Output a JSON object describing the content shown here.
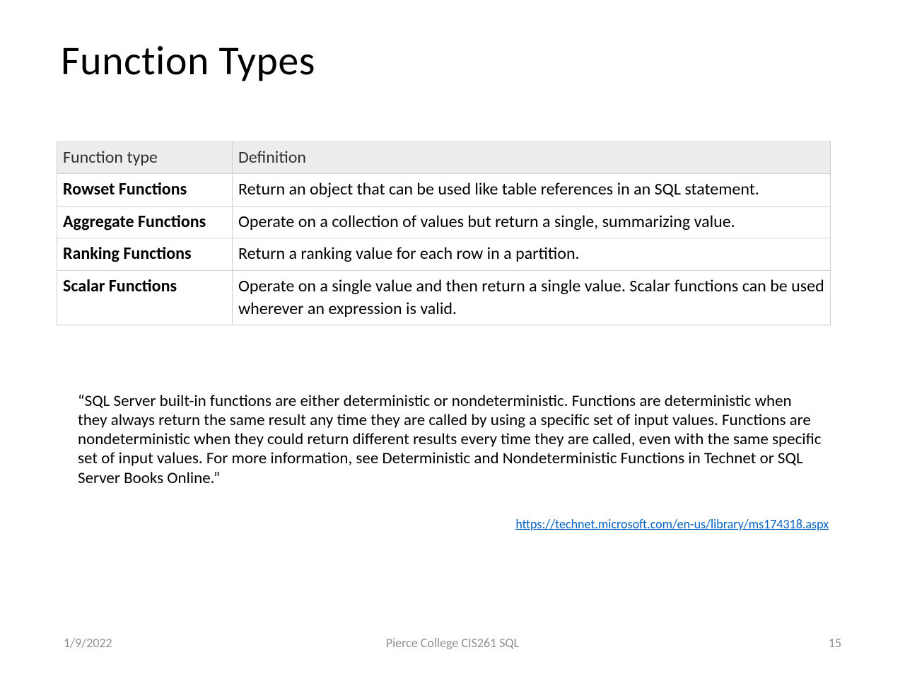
{
  "title": "Function Types",
  "table": {
    "headers": {
      "type": "Function type",
      "definition": "Definition"
    },
    "rows": [
      {
        "type": "Rowset Functions",
        "definition": "Return an object that can be used like table references in an SQL statement."
      },
      {
        "type": "Aggregate Functions",
        "definition": "Operate on a collection of values but return a single, summarizing value."
      },
      {
        "type": "Ranking Functions",
        "definition": "Return a ranking value for each row in a partition."
      },
      {
        "type": "Scalar Functions",
        "definition": "Operate on a single value and then return a single value. Scalar functions can be used wherever an expression is valid."
      }
    ]
  },
  "quote": "“SQL Server built-in functions are either deterministic or nondeterministic. Functions are deterministic when they always return the same result any time they are called by using a specific set of input values. Functions are nondeterministic when they could return different results every time they are called, even with the same specific set of input values. For more information, see Deterministic and Nondeterministic Functions in Technet or SQL Server Books Online.”",
  "citation": {
    "text": "https://technet.microsoft.com/en-us/library/ms174318.aspx",
    "href": "https://technet.microsoft.com/en-us/library/ms174318.aspx"
  },
  "footer": {
    "date": "1/9/2022",
    "course": "Pierce College CIS261 SQL",
    "page": "15"
  }
}
